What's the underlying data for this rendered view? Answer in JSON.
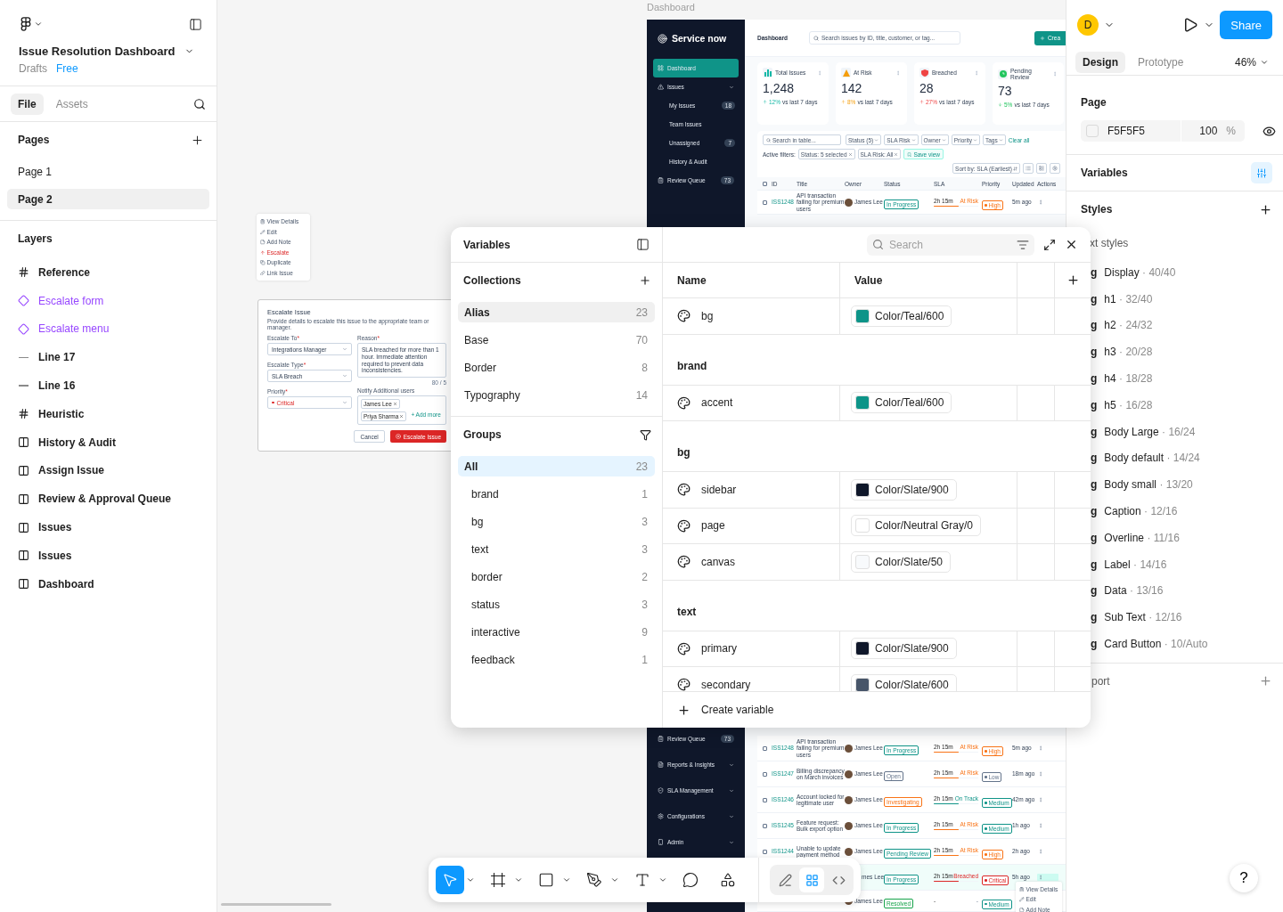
{
  "file": {
    "title": "Issue Resolution Dashboard",
    "location": "Drafts",
    "plan": "Free"
  },
  "left_tabs": [
    {
      "label": "File",
      "selected": true
    },
    {
      "label": "Assets",
      "selected": false
    }
  ],
  "pages": {
    "title": "Pages",
    "items": [
      {
        "label": "Page 1",
        "selected": false
      },
      {
        "label": "Page 2",
        "selected": true
      }
    ]
  },
  "layers": {
    "title": "Layers",
    "items": [
      {
        "label": "Reference",
        "kind": "frame"
      },
      {
        "label": "Escalate form",
        "kind": "component"
      },
      {
        "label": "Escalate menu",
        "kind": "component"
      },
      {
        "label": "Line 17",
        "kind": "line"
      },
      {
        "label": "Line 16",
        "kind": "line"
      },
      {
        "label": "Heuristic",
        "kind": "frame"
      },
      {
        "label": "History & Audit",
        "kind": "section"
      },
      {
        "label": "Assign Issue",
        "kind": "section"
      },
      {
        "label": "Review & Approval Queue",
        "kind": "section"
      },
      {
        "label": "Issues",
        "kind": "section"
      },
      {
        "label": "Issues",
        "kind": "section"
      },
      {
        "label": "Dashboard",
        "kind": "section"
      }
    ]
  },
  "canvas": {
    "action_menu": {
      "items": [
        {
          "label": "View Details",
          "kind": "details"
        },
        {
          "label": "Edit",
          "kind": "edit"
        },
        {
          "label": "Add Note",
          "kind": "note"
        },
        {
          "label": "Escalate",
          "kind": "escalate"
        },
        {
          "label": "Duplicate",
          "kind": "duplicate"
        },
        {
          "label": "Link Issue",
          "kind": "link"
        }
      ]
    },
    "escalate_form": {
      "title": "Escalate Issue",
      "subtitle": "Provide details to escalate this issue to the appropriate team or manager.",
      "fields": [
        {
          "label": "Escalate To",
          "required_mark": "*",
          "value": "Integrations Manager",
          "kind": "plain"
        },
        {
          "label": "Escalate Type",
          "required_mark": "*",
          "value": "SLA Breach",
          "kind": "plain"
        },
        {
          "label": "Priority",
          "required_mark": "*",
          "value": "Critical",
          "kind": "critical"
        }
      ],
      "reason": {
        "label": "Reason",
        "required_mark": "*",
        "value": "SLA breached for more than 1 hour. Immediate attention required to prevent data inconsistencies.",
        "counter": "80 / 5"
      },
      "notify": {
        "label": "Notify Additional users",
        "chips": [
          "James Lee",
          "Priya Sharma"
        ],
        "add": "+ Add more"
      },
      "buttons": {
        "cancel": "Cancel",
        "submit": "Escalate Issue"
      }
    },
    "dashboard": {
      "frame_label": "Dashboard",
      "brand": "Service now",
      "nav_top": [
        {
          "label": "Dashboard",
          "kind": "main",
          "selected": true,
          "has_menu": false
        },
        {
          "label": "Issues",
          "kind": "main",
          "selected": false,
          "has_menu": true
        },
        {
          "label": "My Issues",
          "kind": "sub",
          "selected": false,
          "has_menu": false,
          "count": "18"
        },
        {
          "label": "Team Issues",
          "kind": "sub",
          "selected": false,
          "has_menu": false
        },
        {
          "label": "Unassigned",
          "kind": "sub",
          "selected": false,
          "has_menu": false,
          "count": "7"
        },
        {
          "label": "History & Audit",
          "kind": "sub",
          "selected": false,
          "has_menu": false
        },
        {
          "label": "Review Queue",
          "kind": "main",
          "selected": false,
          "has_menu": false,
          "count": "73"
        }
      ],
      "nav_bottom": [
        {
          "label": "Review Queue",
          "kind": "main",
          "selected": false,
          "has_menu": false,
          "count": "73"
        },
        {
          "label": "Reports & Insights",
          "kind": "main",
          "selected": false,
          "has_menu": true
        },
        {
          "label": "SLA Management",
          "kind": "main",
          "selected": false,
          "has_menu": true
        },
        {
          "label": "Configurations",
          "kind": "main",
          "selected": false,
          "has_menu": true
        },
        {
          "label": "Admin",
          "kind": "main",
          "selected": false,
          "has_menu": true
        }
      ],
      "header": {
        "title": "Dashboard",
        "search_placeholder": "Search issues by ID, title, customer, or tag...",
        "create": "Crea"
      },
      "stats": [
        {
          "label": "Total Issues",
          "value": "1,248",
          "change": "12%",
          "rising": true,
          "note": "vs last 7 days",
          "color": "#14b8a6"
        },
        {
          "label": "At Risk",
          "value": "142",
          "change": "8%",
          "rising": true,
          "note": "vs last 7 days",
          "color": "#f59e0b"
        },
        {
          "label": "Breached",
          "value": "28",
          "change": "27%",
          "rising": true,
          "note": "vs last 7 days",
          "color": "#ef4444"
        },
        {
          "label": "Pending Review",
          "value": "73",
          "change": "5%",
          "rising": false,
          "note": "vs last 7 days",
          "color": "#22c55e"
        }
      ],
      "filters": {
        "search_placeholder": "Search in table...",
        "chips": [
          "Status (5)",
          "SLA Risk",
          "Owner",
          "Priority",
          "Tags"
        ],
        "clear": "Clear all",
        "active_label": "Active filters:",
        "active": [
          "Status: 5 selected",
          "SLA Risk: All"
        ],
        "save": "Save view",
        "sort": "Sort by: SLA (Earliest)"
      },
      "columns": [
        "ID",
        "Title",
        "Owner",
        "Status",
        "SLA",
        "Priority",
        "Updated",
        "Actions"
      ],
      "all_checked": false,
      "top_rows": [
        {
          "id": "ISS1248",
          "checked": false,
          "title": "API transaction failing for premium users",
          "owner": "James Lee",
          "avatar": true,
          "status": {
            "text": "In Progress",
            "color": "#0f9488"
          },
          "sla": {
            "time": "2h 15m",
            "state": "At Risk",
            "color": "#f97316",
            "level": 0.55
          },
          "priority": {
            "text": "High",
            "color": "#f97316"
          },
          "updated": "5m ago",
          "highlighted": false
        }
      ],
      "bottom_rows": [
        {
          "id": "ISS1248",
          "checked": false,
          "title": "API transaction failing for premium users",
          "owner": "James Lee",
          "avatar": true,
          "status": {
            "text": "In Progress",
            "color": "#0f9488"
          },
          "sla": {
            "time": "2h 15m",
            "state": "At Risk",
            "color": "#f97316",
            "level": 0.55
          },
          "priority": {
            "text": "High",
            "color": "#f97316"
          },
          "updated": "5m ago",
          "highlighted": false
        },
        {
          "id": "ISS1247",
          "checked": false,
          "title": "Billing discrepancy on March invoices",
          "owner": "James Lee",
          "avatar": true,
          "status": {
            "text": "Open",
            "color": "#64748b"
          },
          "sla": {
            "time": "2h 15m",
            "state": "At Risk",
            "color": "#f97316",
            "level": 0.55
          },
          "priority": {
            "text": "Low",
            "color": "#64748b"
          },
          "updated": "18m ago",
          "highlighted": false
        },
        {
          "id": "ISS1246",
          "checked": false,
          "title": "Account locked for legitimate user",
          "owner": "James Lee",
          "avatar": true,
          "status": {
            "text": "Investigating",
            "color": "#f97316"
          },
          "sla": {
            "time": "2h 15m",
            "state": "On Track",
            "color": "#0f9488",
            "level": 0.55
          },
          "priority": {
            "text": "Medium",
            "color": "#0f9488"
          },
          "updated": "42m ago",
          "highlighted": false
        },
        {
          "id": "ISS1245",
          "checked": false,
          "title": "Feature request: Bulk export option",
          "owner": "James Lee",
          "avatar": true,
          "status": {
            "text": "In Progress",
            "color": "#0f9488"
          },
          "sla": {
            "time": "2h 15m",
            "state": "At Risk",
            "color": "#f97316",
            "level": 0.55
          },
          "priority": {
            "text": "Medium",
            "color": "#0f9488"
          },
          "updated": "1h ago",
          "highlighted": false
        },
        {
          "id": "ISS1244",
          "checked": false,
          "title": "Unable to update payment method",
          "owner": "James Lee",
          "avatar": true,
          "status": {
            "text": "Pending Review",
            "color": "#0f9488"
          },
          "sla": {
            "time": "2h 15m",
            "state": "At Risk",
            "color": "#f97316",
            "level": 0.55
          },
          "priority": {
            "text": "High",
            "color": "#f97316"
          },
          "updated": "2h ago",
          "highlighted": false
        },
        {
          "owner": "mes Lee",
          "avatar": false,
          "status": {
            "text": "In Progress",
            "color": "#0f9488"
          },
          "sla": {
            "time": "2h 15m",
            "state": "Breached",
            "color": "#dc2626",
            "level": 0.55
          },
          "priority": {
            "text": "Critical",
            "color": "#dc2626"
          },
          "updated": "5h ago",
          "highlighted": true
        },
        {
          "owner": "James Lee",
          "avatar": true,
          "status": {
            "text": "Resolved",
            "color": "#16a34a"
          },
          "sla": {
            "time": "-",
            "state": "-"
          },
          "priority": {
            "text": "Medium",
            "color": "#0f9488"
          },
          "highlighted": false
        }
      ],
      "row_menu": [
        "View Details",
        "Edit",
        "Add Note"
      ]
    }
  },
  "variables_panel": {
    "title": "Variables",
    "search_placeholder": "Search",
    "collections": {
      "title": "Collections",
      "items": [
        {
          "label": "Alias",
          "count": "23",
          "selected": true
        },
        {
          "label": "Base",
          "count": "70",
          "selected": false
        },
        {
          "label": "Border",
          "count": "8",
          "selected": false
        },
        {
          "label": "Typography",
          "count": "14",
          "selected": false
        }
      ]
    },
    "groups": {
      "title": "Groups",
      "items": [
        {
          "label": "All",
          "count": "23",
          "selected": true
        },
        {
          "label": "brand",
          "count": "1",
          "selected": false
        },
        {
          "label": "bg",
          "count": "3",
          "selected": false
        },
        {
          "label": "text",
          "count": "3",
          "selected": false
        },
        {
          "label": "border",
          "count": "2",
          "selected": false
        },
        {
          "label": "status",
          "count": "3",
          "selected": false
        },
        {
          "label": "interactive",
          "count": "9",
          "selected": false
        },
        {
          "label": "feedback",
          "count": "1",
          "selected": false
        }
      ]
    },
    "columns": [
      "Name",
      "Value"
    ],
    "rows": [
      {
        "kind": "variable",
        "name": "bg",
        "value": "Color/Teal/600",
        "color": "#0d9488"
      },
      {
        "kind": "group",
        "name": "brand"
      },
      {
        "kind": "variable",
        "name": "accent",
        "value": "Color/Teal/600",
        "color": "#0d9488"
      },
      {
        "kind": "group",
        "name": "bg"
      },
      {
        "kind": "variable",
        "name": "sidebar",
        "value": "Color/Slate/900",
        "color": "#0f172a"
      },
      {
        "kind": "variable",
        "name": "page",
        "value": "Color/Neutral Gray/0",
        "color": "#ffffff"
      },
      {
        "kind": "variable",
        "name": "canvas",
        "value": "Color/Slate/50",
        "color": "#f8fafc"
      },
      {
        "kind": "group",
        "name": "text"
      },
      {
        "kind": "variable",
        "name": "primary",
        "value": "Color/Slate/900",
        "color": "#0f172a"
      },
      {
        "kind": "variable",
        "name": "secondary",
        "value": "Color/Slate/600",
        "color": "#475569"
      }
    ],
    "create": "Create variable"
  },
  "toolbar": {
    "tools": [
      {
        "kind": "move",
        "selected": true,
        "caret": true
      },
      {
        "kind": "frame",
        "selected": false,
        "caret": true
      },
      {
        "kind": "shape",
        "selected": false,
        "caret": true
      },
      {
        "kind": "pen",
        "selected": false,
        "caret": true
      },
      {
        "kind": "text",
        "selected": false,
        "caret": true
      },
      {
        "kind": "comment",
        "selected": false,
        "caret": false
      },
      {
        "kind": "actions",
        "selected": false,
        "caret": false
      }
    ],
    "modes": [
      {
        "kind": "draw",
        "selected": false
      },
      {
        "kind": "design",
        "selected": true
      },
      {
        "kind": "dev",
        "selected": false
      }
    ]
  },
  "help": "?",
  "right_panel": {
    "avatar": "D",
    "share": "Share",
    "tabs": [
      {
        "label": "Design",
        "selected": true
      },
      {
        "label": "Prototype",
        "selected": false
      }
    ],
    "zoom": "46%",
    "page": {
      "title": "Page",
      "color": "F5F5F5",
      "opacity": "100",
      "unit": "%"
    },
    "variables": "Variables",
    "styles": "Styles",
    "text_styles": "xt styles",
    "style_items": [
      {
        "glyph": "g",
        "name": "Display",
        "spec": "· 40/40"
      },
      {
        "glyph": "g",
        "name": "h1",
        "spec": "· 32/40"
      },
      {
        "glyph": "g",
        "name": "h2",
        "spec": "· 24/32"
      },
      {
        "glyph": "g",
        "name": "h3",
        "spec": "· 20/28"
      },
      {
        "glyph": "g",
        "name": "h4",
        "spec": "· 18/28"
      },
      {
        "glyph": "g",
        "name": "h5",
        "spec": "· 16/28"
      },
      {
        "glyph": "g",
        "name": "Body Large",
        "spec": "· 16/24"
      },
      {
        "glyph": "g",
        "name": "Body default",
        "spec": "· 14/24"
      },
      {
        "glyph": "g",
        "name": "Body small",
        "spec": "· 13/20"
      },
      {
        "glyph": "g",
        "name": "Caption",
        "spec": "· 12/16"
      },
      {
        "glyph": "g",
        "name": "Overline",
        "spec": "· 11/16"
      },
      {
        "glyph": "g",
        "name": "Label",
        "spec": "· 14/16"
      },
      {
        "glyph": "g",
        "name": "Data",
        "spec": "· 13/16"
      },
      {
        "glyph": "g",
        "name": "Sub Text",
        "spec": "· 12/16"
      },
      {
        "glyph": "g",
        "name": "Card Button",
        "spec": "· 10/Auto"
      }
    ],
    "export": "port"
  }
}
